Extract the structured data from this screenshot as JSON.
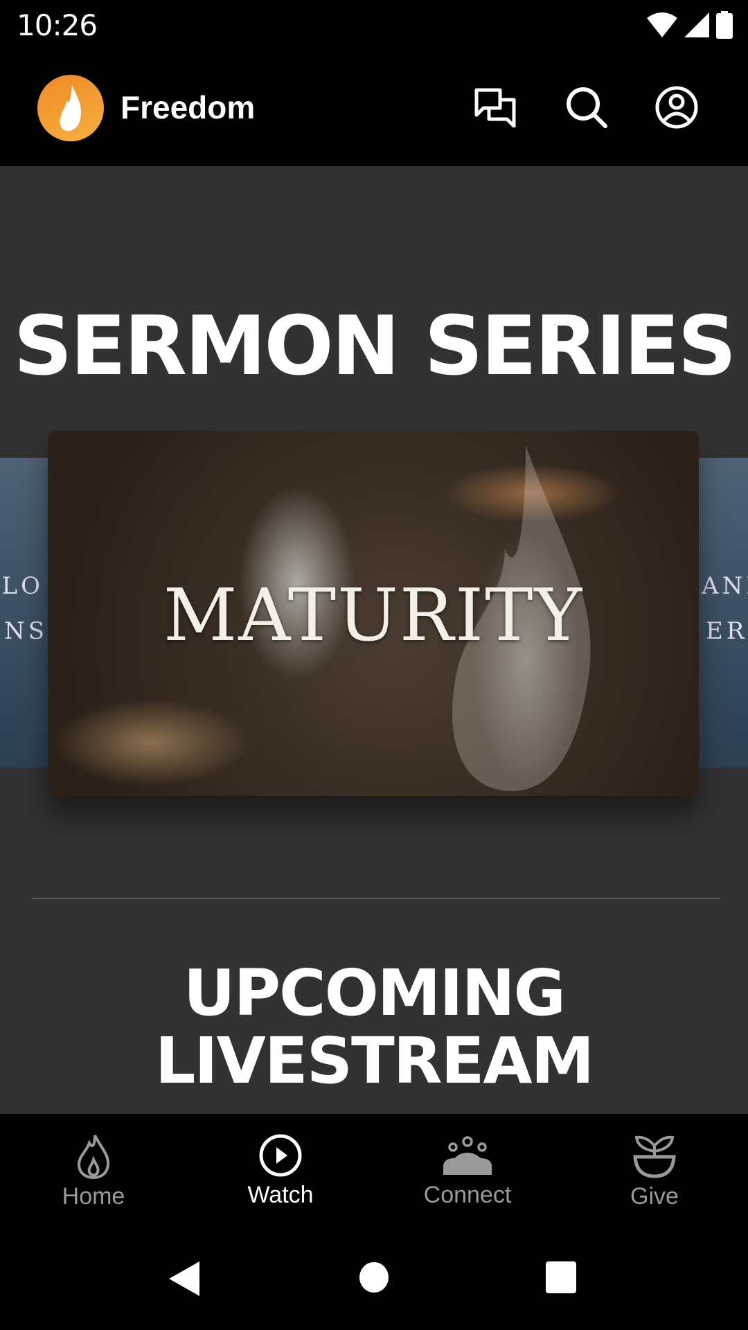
{
  "status_bar": {
    "time": "10:26",
    "icons": [
      "wifi-icon",
      "signal-icon",
      "battery-icon"
    ]
  },
  "header": {
    "app_name": "Freedom",
    "logo_icon": "flame-logo-icon",
    "actions": [
      "chat-icon",
      "search-icon",
      "account-icon"
    ]
  },
  "colors": {
    "accent": "#f39a2c",
    "background": "#323232",
    "bar": "#000000",
    "inactive": "#9a9a9a"
  },
  "sermon_series": {
    "title": "SERMON SERIES",
    "current_card": {
      "title": "MATURITY"
    },
    "prev_card": {
      "line1": "ALO",
      "line2": "ONS"
    },
    "next_card": {
      "line1": "AND",
      "line2": "ERM"
    }
  },
  "upcoming": {
    "title_line1": "UPCOMING",
    "title_line2": "LIVESTREAM"
  },
  "bottom_nav": {
    "items": [
      {
        "label": "Home",
        "icon": "flame-icon"
      },
      {
        "label": "Watch",
        "icon": "play-circle-icon",
        "active": true
      },
      {
        "label": "Connect",
        "icon": "group-icon"
      },
      {
        "label": "Give",
        "icon": "plant-icon"
      }
    ]
  },
  "system_nav": [
    "back-icon",
    "home-icon",
    "recents-icon"
  ]
}
